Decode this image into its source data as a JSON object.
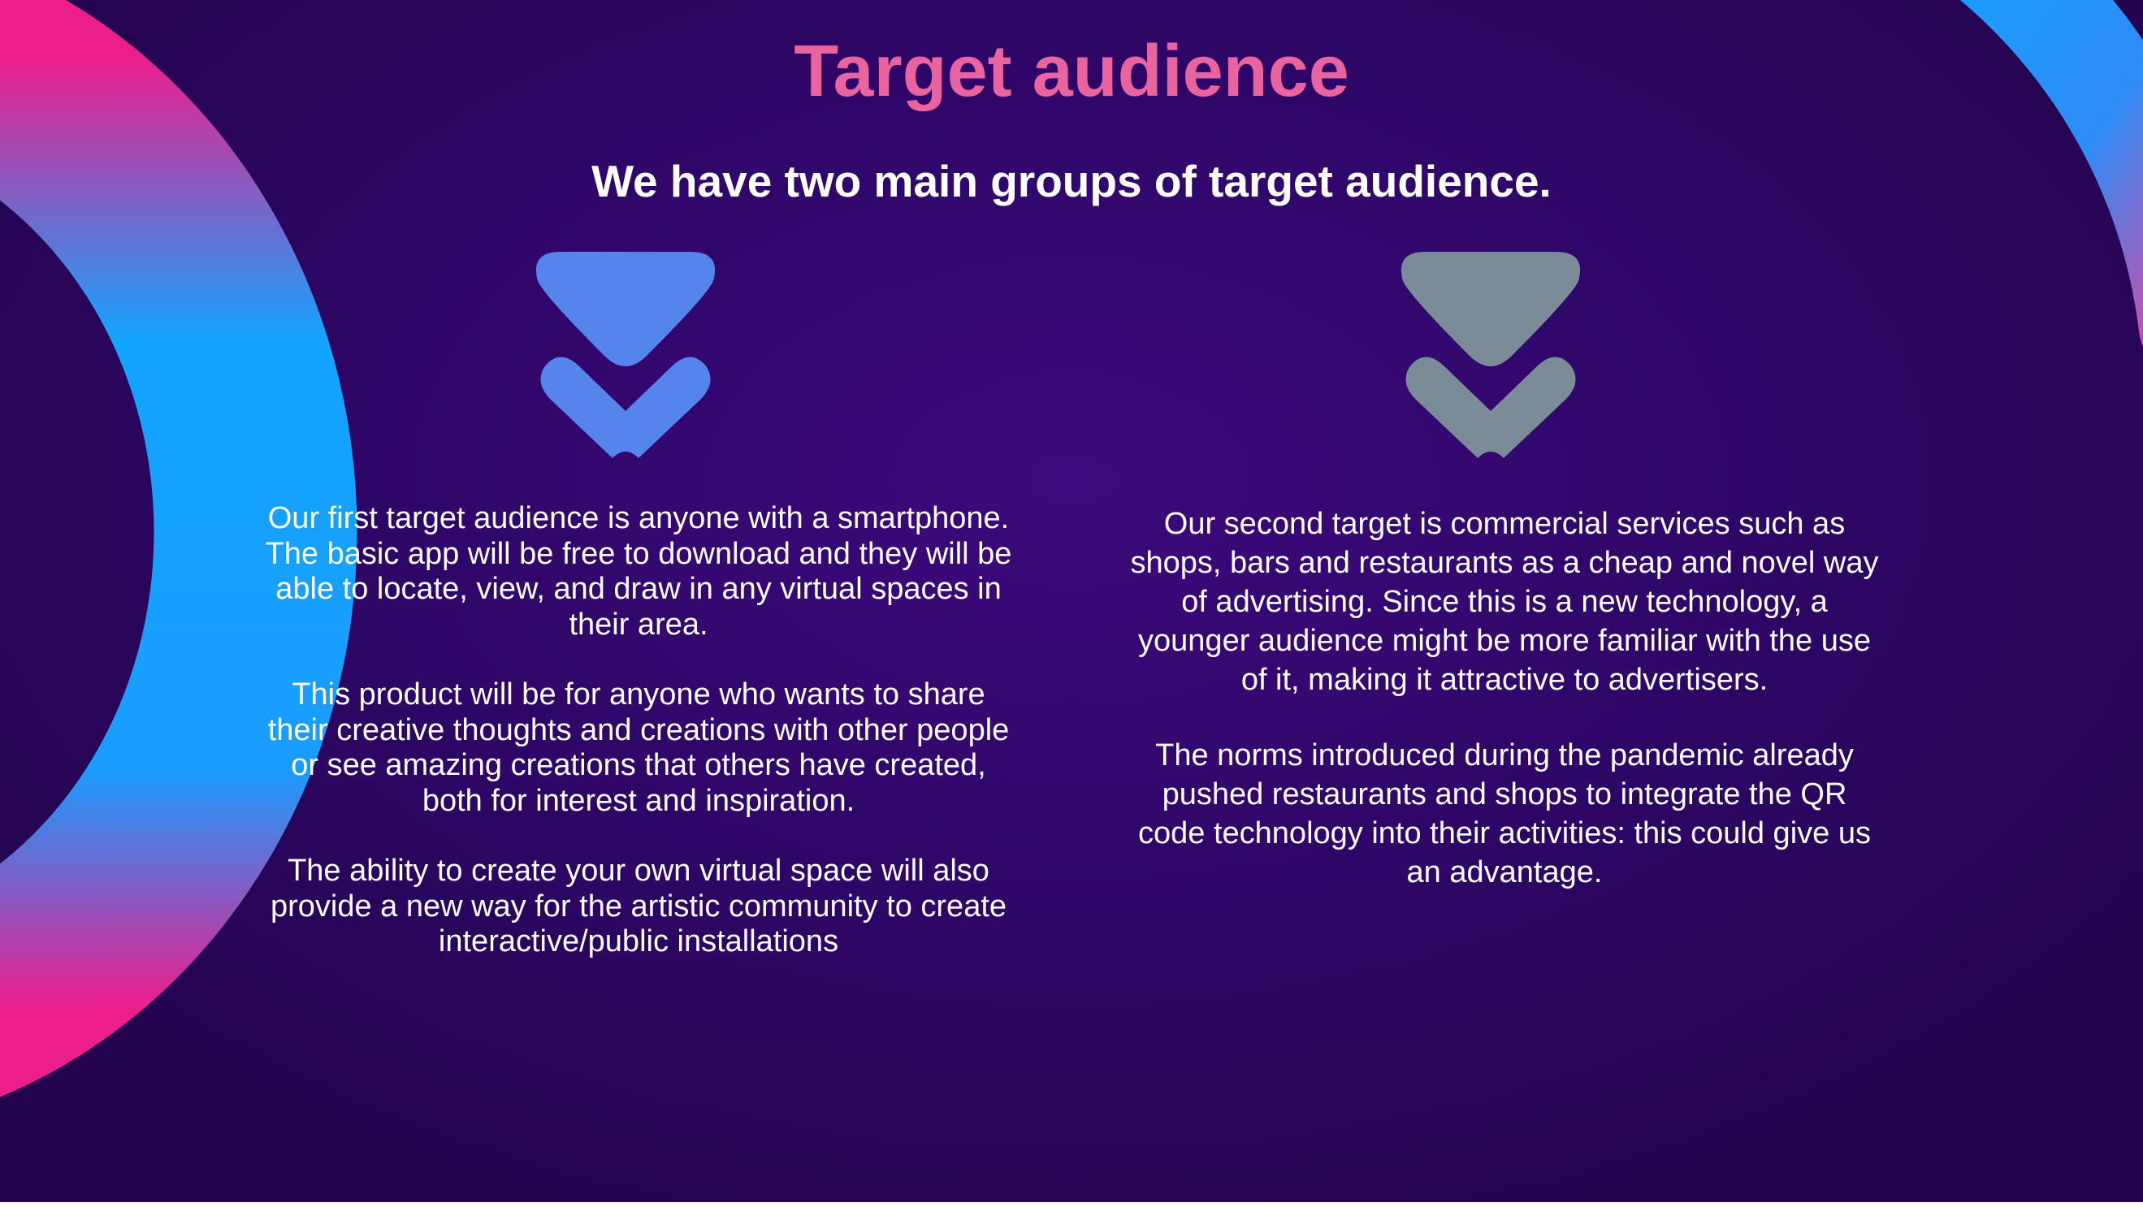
{
  "slide": {
    "title": "Target audience",
    "subtitle": "We have two main groups of target audience.",
    "colors": {
      "background": "#2e0667",
      "title": "#e9639f",
      "text": "#ffffff",
      "chevron_left": "#5484ec",
      "chevron_right": "#7a8c98",
      "ring_blue": "#12a4ff",
      "ring_pink": "#ec1e8c"
    },
    "left_column": {
      "icon": "double-chevron-down-icon",
      "paragraphs": [
        "Our first target audience is anyone with a smartphone. The basic app will be free to download and they will be able to locate, view, and draw in any virtual spaces in their area.",
        "This product will be for anyone who wants to share their creative thoughts and creations with other people or see amazing creations that others have created, both for interest and inspiration.",
        "The ability to create your own virtual space will also provide a new way for the artistic community to create interactive/public installations"
      ]
    },
    "right_column": {
      "icon": "double-chevron-down-icon",
      "paragraphs": [
        "Our second target is commercial services such as shops, bars and restaurants as a cheap and novel way of advertising. Since this is a new technology, a younger audience might be more familiar with the use of it, making it attractive to advertisers.",
        "The norms introduced during the pandemic already pushed restaurants and shops to integrate the QR code technology into their activities: this could give us an advantage."
      ]
    }
  }
}
